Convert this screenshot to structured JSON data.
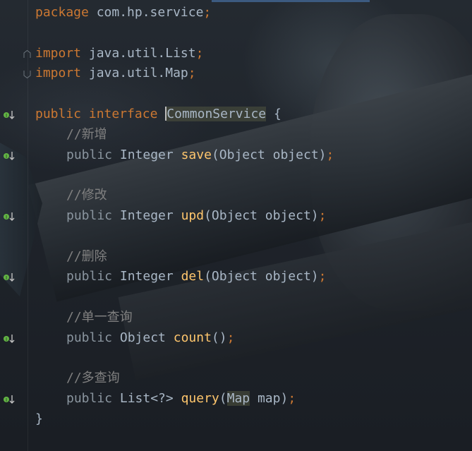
{
  "editor": {
    "line_package": {
      "kw": "package",
      "rest": " com.hp.service",
      "semi": ";"
    },
    "line_import1": {
      "kw": "import",
      "rest": " java.util.List",
      "semi": ";"
    },
    "line_import2": {
      "kw": "import",
      "rest": " java.util.Map",
      "semi": ";"
    },
    "line_interface": {
      "kw1": "public",
      "kw2": "interface",
      "name": "CommonService",
      "brace": " {"
    },
    "comment_add": "//新增",
    "method_save": {
      "mod": "public",
      "type": " Integer ",
      "name": "save",
      "params": "(Object object)",
      "semi": ";"
    },
    "comment_upd": "//修改",
    "method_upd": {
      "mod": "public",
      "type": " Integer ",
      "name": "upd",
      "params": "(Object object)",
      "semi": ";"
    },
    "comment_del": "//删除",
    "method_del": {
      "mod": "public",
      "type": " Integer ",
      "name": "del",
      "params": "(Object object)",
      "semi": ";"
    },
    "comment_count": "//单一查询",
    "method_count": {
      "mod": "public",
      "type": " Object ",
      "name": "count",
      "params": "()",
      "semi": ";"
    },
    "comment_query": "//多查询",
    "method_query": {
      "mod": "public",
      "type": " List<?> ",
      "name": "query",
      "paren_open": "(",
      "param_type": "Map",
      "param_rest": " map)",
      "semi": ";"
    },
    "closing_brace": "}"
  },
  "colors": {
    "keyword": "#cc7832",
    "function": "#ffc66d",
    "comment": "#808080",
    "text": "#a9b7c6",
    "gutter_icon": "#62b543"
  },
  "icons": {
    "implemented": "implemented-method-icon",
    "fold": "fold-marker-icon"
  }
}
